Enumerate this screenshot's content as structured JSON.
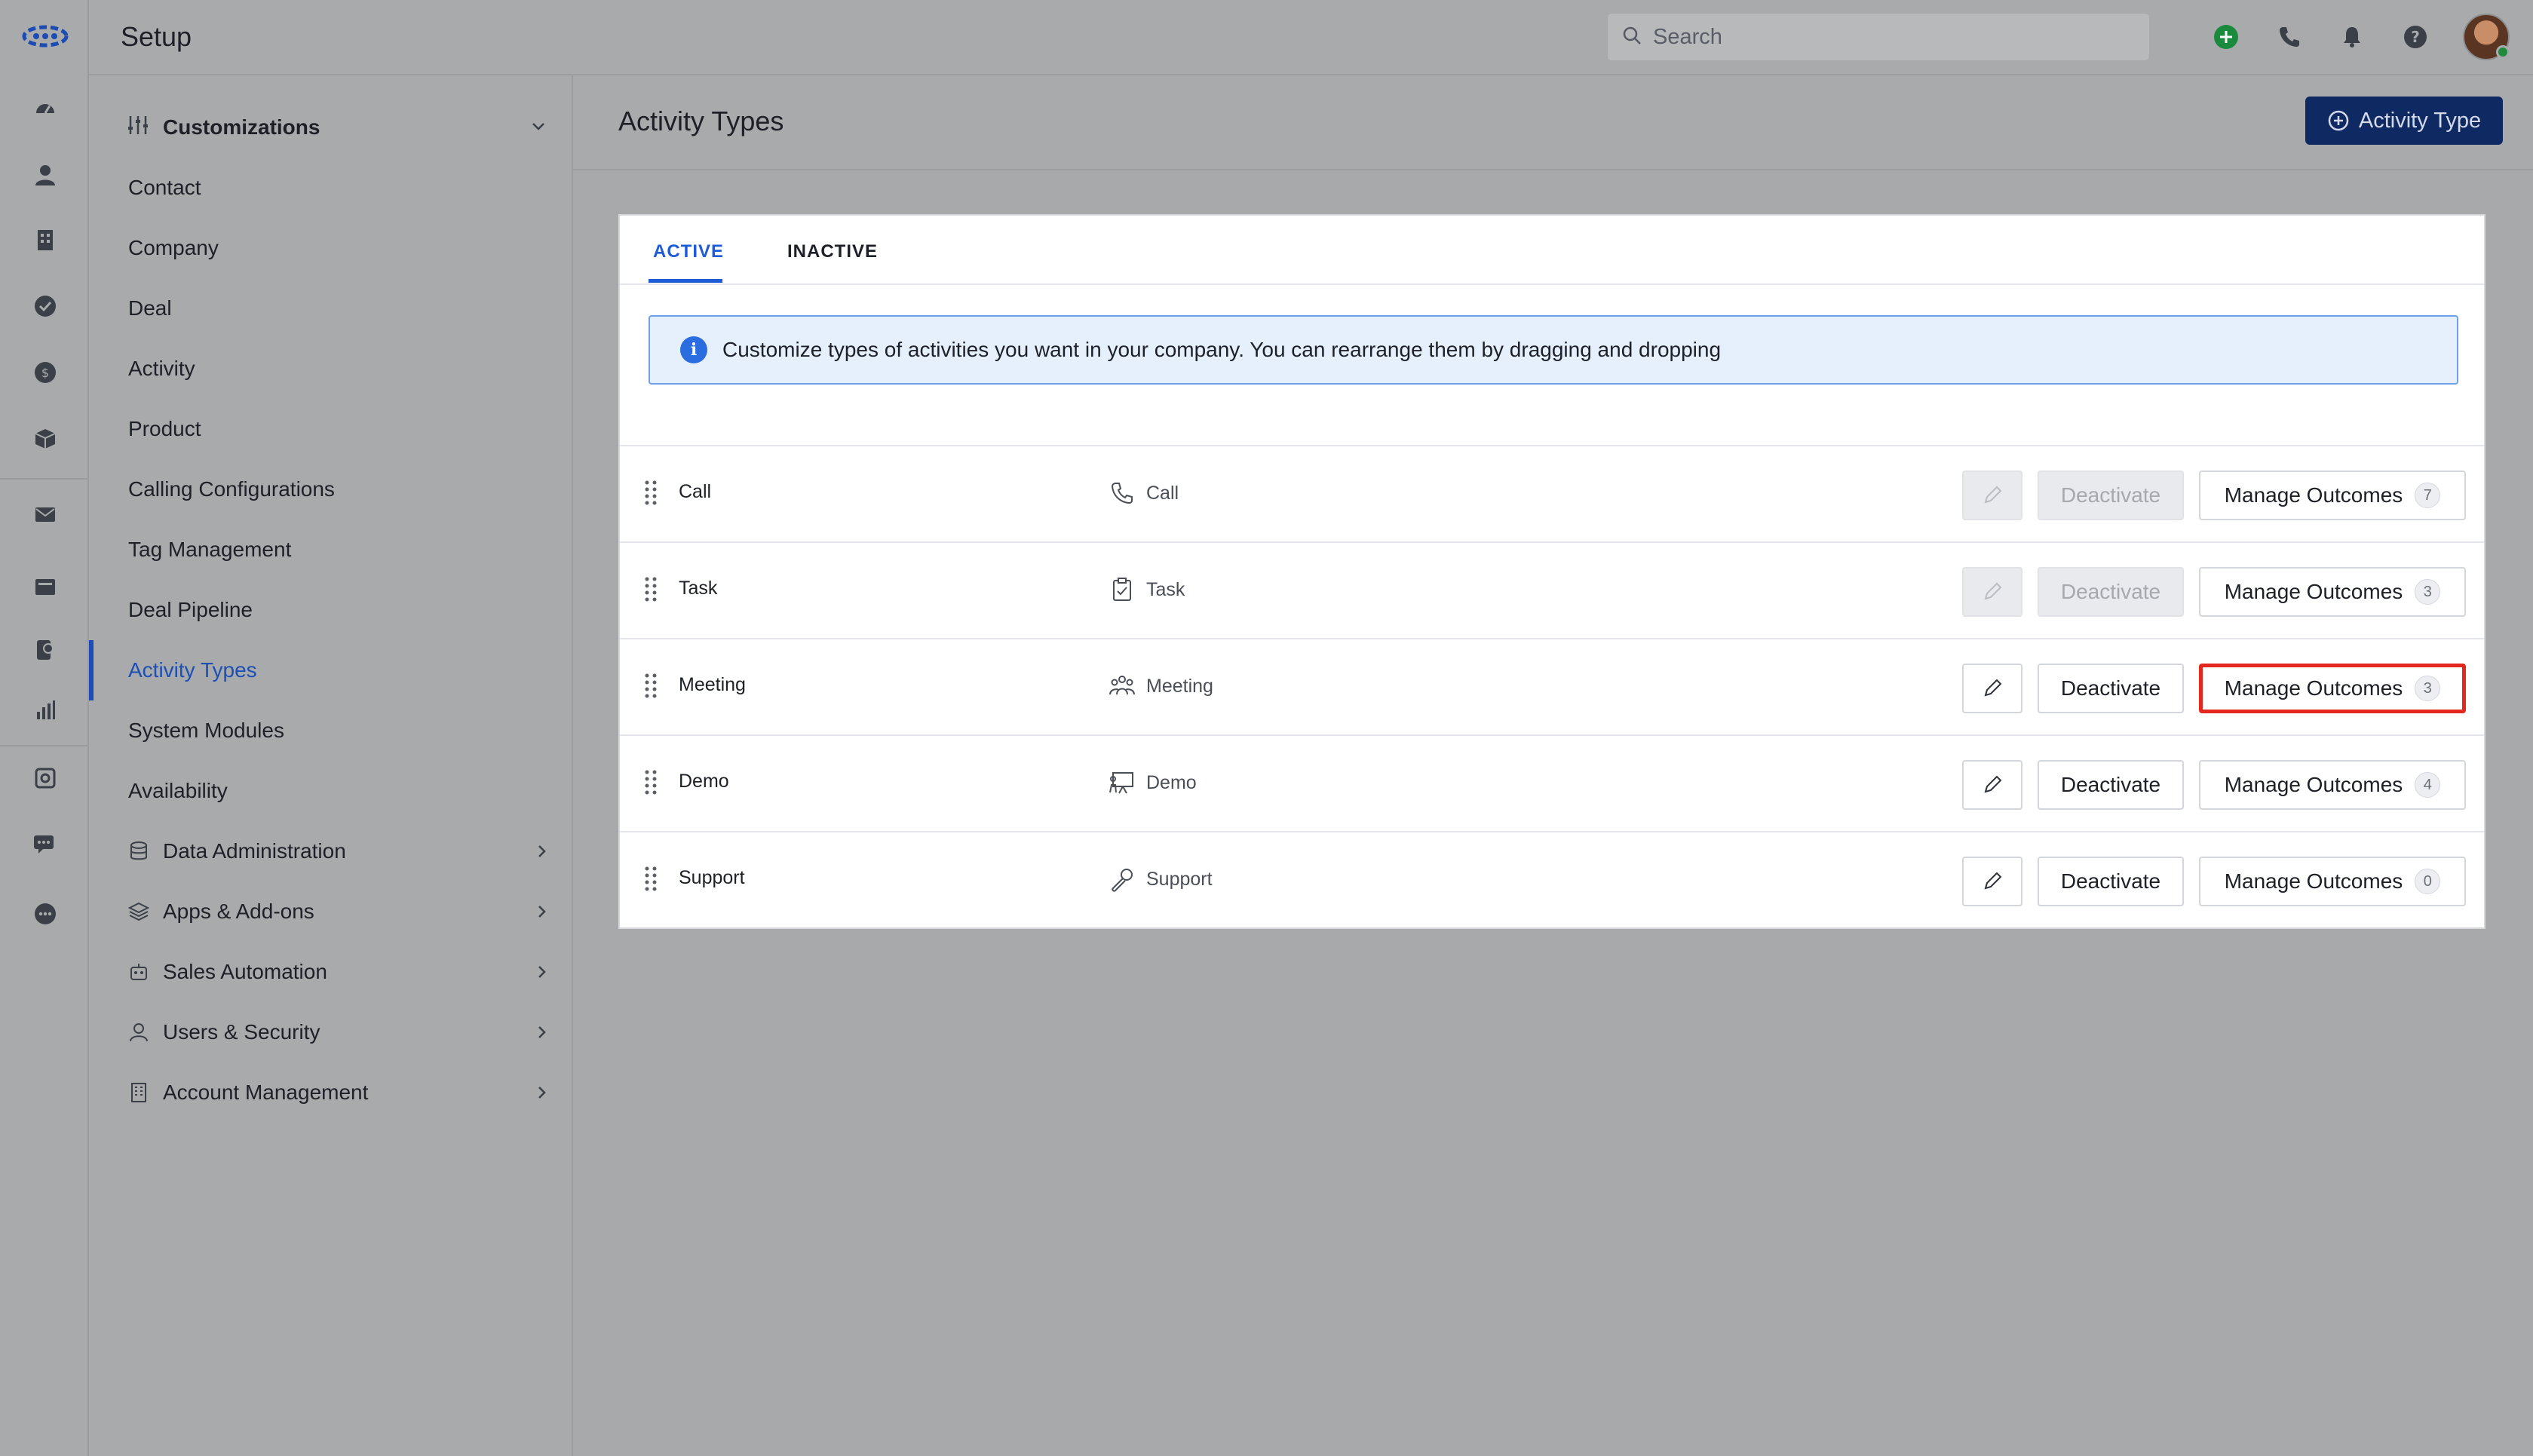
{
  "header": {
    "title": "Setup",
    "search_placeholder": "Search",
    "icons": [
      "add-icon",
      "phone-icon",
      "bell-icon",
      "help-icon"
    ]
  },
  "rail": {
    "icons": [
      "logo-icon",
      "dashboard-icon",
      "contact-icon",
      "company-icon",
      "task-icon",
      "deal-icon",
      "product-icon",
      "mail-icon",
      "inbox-icon",
      "chat-icon",
      "report-icon",
      "settings-icon",
      "messages-icon",
      "more-icon"
    ]
  },
  "sidebar": {
    "group_label": "Customizations",
    "items": [
      {
        "label": "Contact"
      },
      {
        "label": "Company"
      },
      {
        "label": "Deal"
      },
      {
        "label": "Activity"
      },
      {
        "label": "Product"
      },
      {
        "label": "Calling Configurations"
      },
      {
        "label": "Tag Management"
      },
      {
        "label": "Deal Pipeline"
      },
      {
        "label": "Activity Types",
        "active": true
      },
      {
        "label": "System Modules"
      },
      {
        "label": "Availability"
      }
    ],
    "sections": [
      {
        "label": "Data Administration",
        "icon": "database-icon"
      },
      {
        "label": "Apps & Add-ons",
        "icon": "layers-icon"
      },
      {
        "label": "Sales Automation",
        "icon": "robot-icon"
      },
      {
        "label": "Users & Security",
        "icon": "user-icon"
      },
      {
        "label": "Account Management",
        "icon": "building-icon"
      }
    ]
  },
  "page": {
    "title": "Activity Types",
    "add_button": "Activity Type"
  },
  "tabs": [
    {
      "label": "ACTIVE",
      "active": true
    },
    {
      "label": "INACTIVE",
      "active": false
    }
  ],
  "banner": "Customize types of activities you want in your company. You can rearrange them by dragging and dropping",
  "rows": [
    {
      "name": "Call",
      "type": "Call",
      "type_icon": "phone-icon",
      "deactivate": "Deactivate",
      "outcomes_label": "Manage Outcomes",
      "outcomes_count": "7",
      "editable": false
    },
    {
      "name": "Task",
      "type": "Task",
      "type_icon": "clipboard-icon",
      "deactivate": "Deactivate",
      "outcomes_label": "Manage Outcomes",
      "outcomes_count": "3",
      "editable": false
    },
    {
      "name": "Meeting",
      "type": "Meeting",
      "type_icon": "people-icon",
      "deactivate": "Deactivate",
      "outcomes_label": "Manage Outcomes",
      "outcomes_count": "3",
      "editable": true
    },
    {
      "name": "Demo",
      "type": "Demo",
      "type_icon": "presentation-icon",
      "deactivate": "Deactivate",
      "outcomes_label": "Manage Outcomes",
      "outcomes_count": "4",
      "editable": true
    },
    {
      "name": "Support",
      "type": "Support",
      "type_icon": "wrench-icon",
      "deactivate": "Deactivate",
      "outcomes_label": "Manage Outcomes",
      "outcomes_count": "0",
      "editable": true
    }
  ],
  "colors": {
    "accent": "#1e5bd6",
    "primary_button": "#0f2a63",
    "highlight": "#e4281f"
  }
}
